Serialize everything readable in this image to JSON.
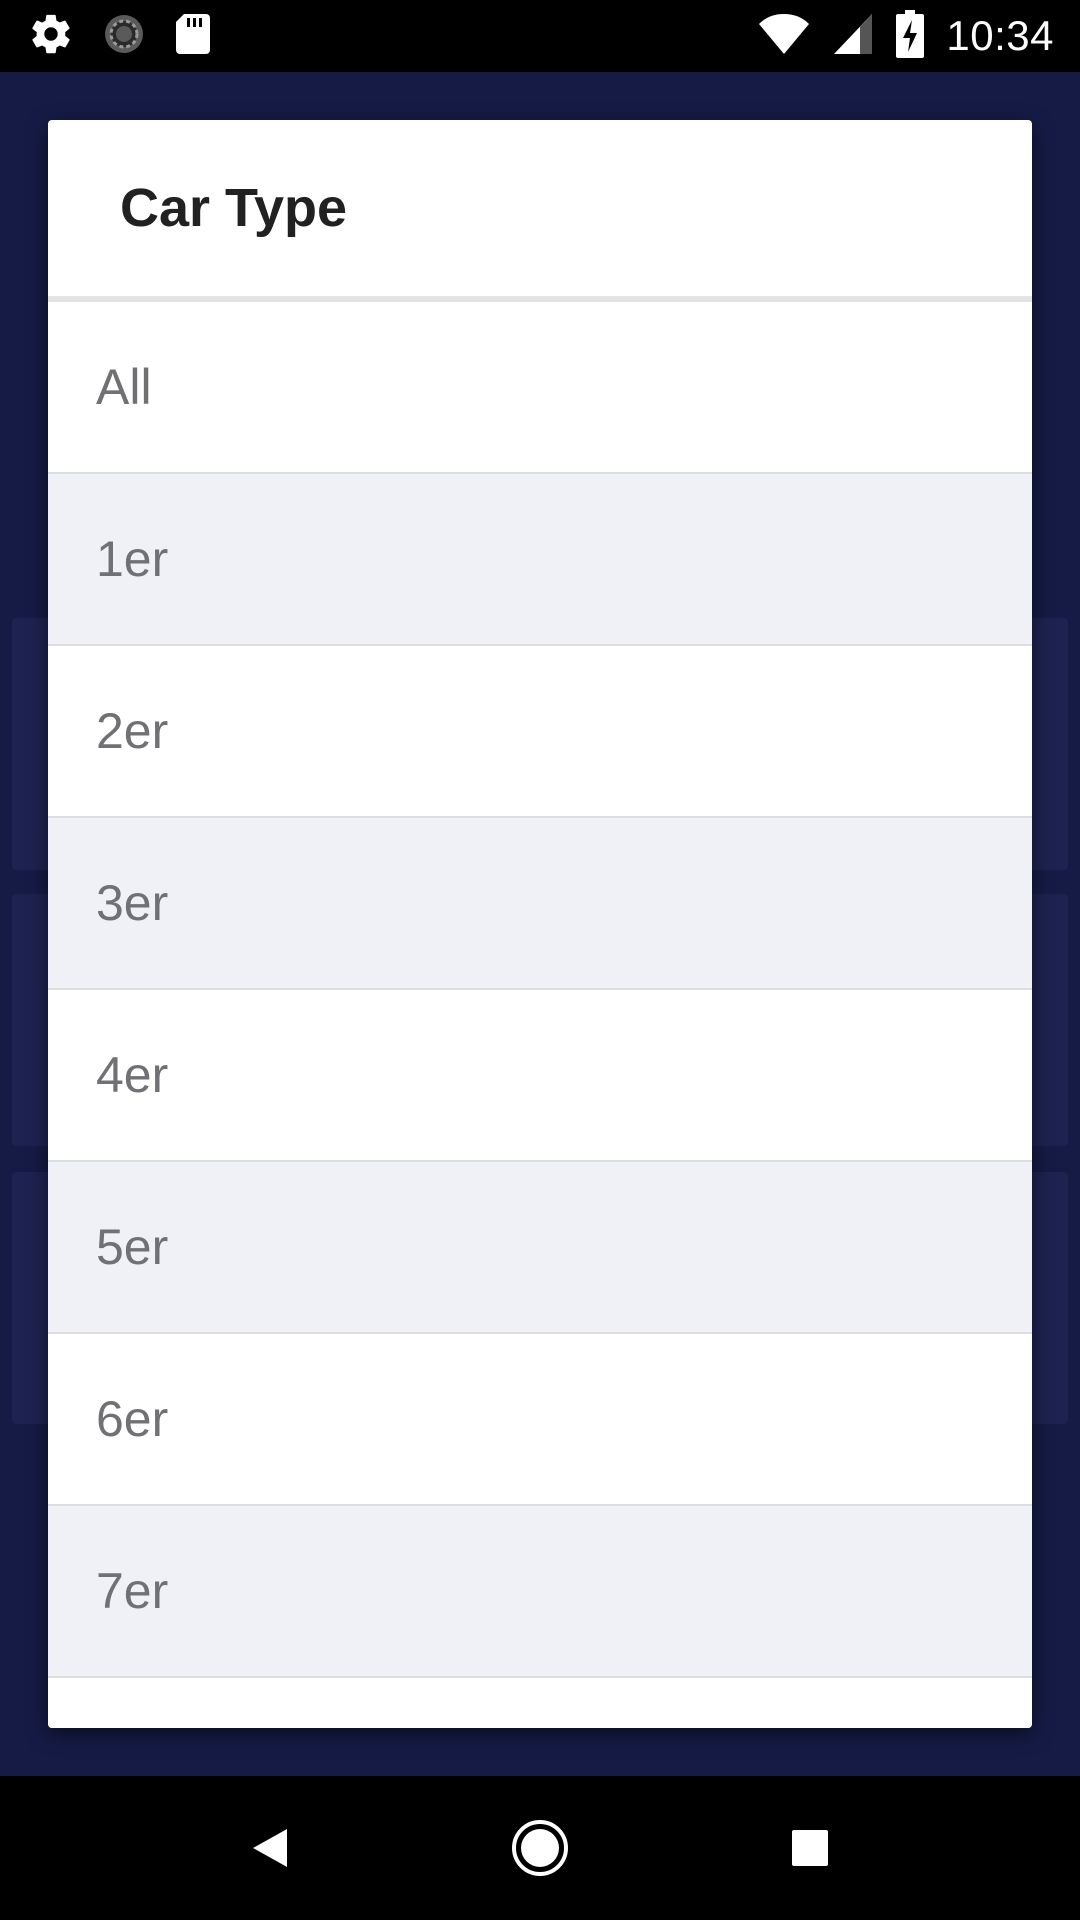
{
  "status_bar": {
    "time": "10:34",
    "left_icons": [
      "gear-icon",
      "sync-icon",
      "sd-card-icon"
    ],
    "right_icons": [
      "wifi-icon",
      "cell-signal-icon",
      "battery-charging-icon"
    ]
  },
  "dialog": {
    "title": "Car Type",
    "options": [
      {
        "label": "All"
      },
      {
        "label": "1er"
      },
      {
        "label": "2er"
      },
      {
        "label": "3er"
      },
      {
        "label": "4er"
      },
      {
        "label": "5er"
      },
      {
        "label": "6er"
      },
      {
        "label": "7er"
      },
      {
        "label": ""
      }
    ]
  },
  "nav_bar": {
    "buttons": [
      "back-icon",
      "home-icon",
      "recents-icon"
    ]
  },
  "colors": {
    "background": "#151b45",
    "dialog": "#ffffff",
    "row_alt": "#f0f1f6",
    "title_text": "#212121",
    "option_text": "#707075"
  }
}
